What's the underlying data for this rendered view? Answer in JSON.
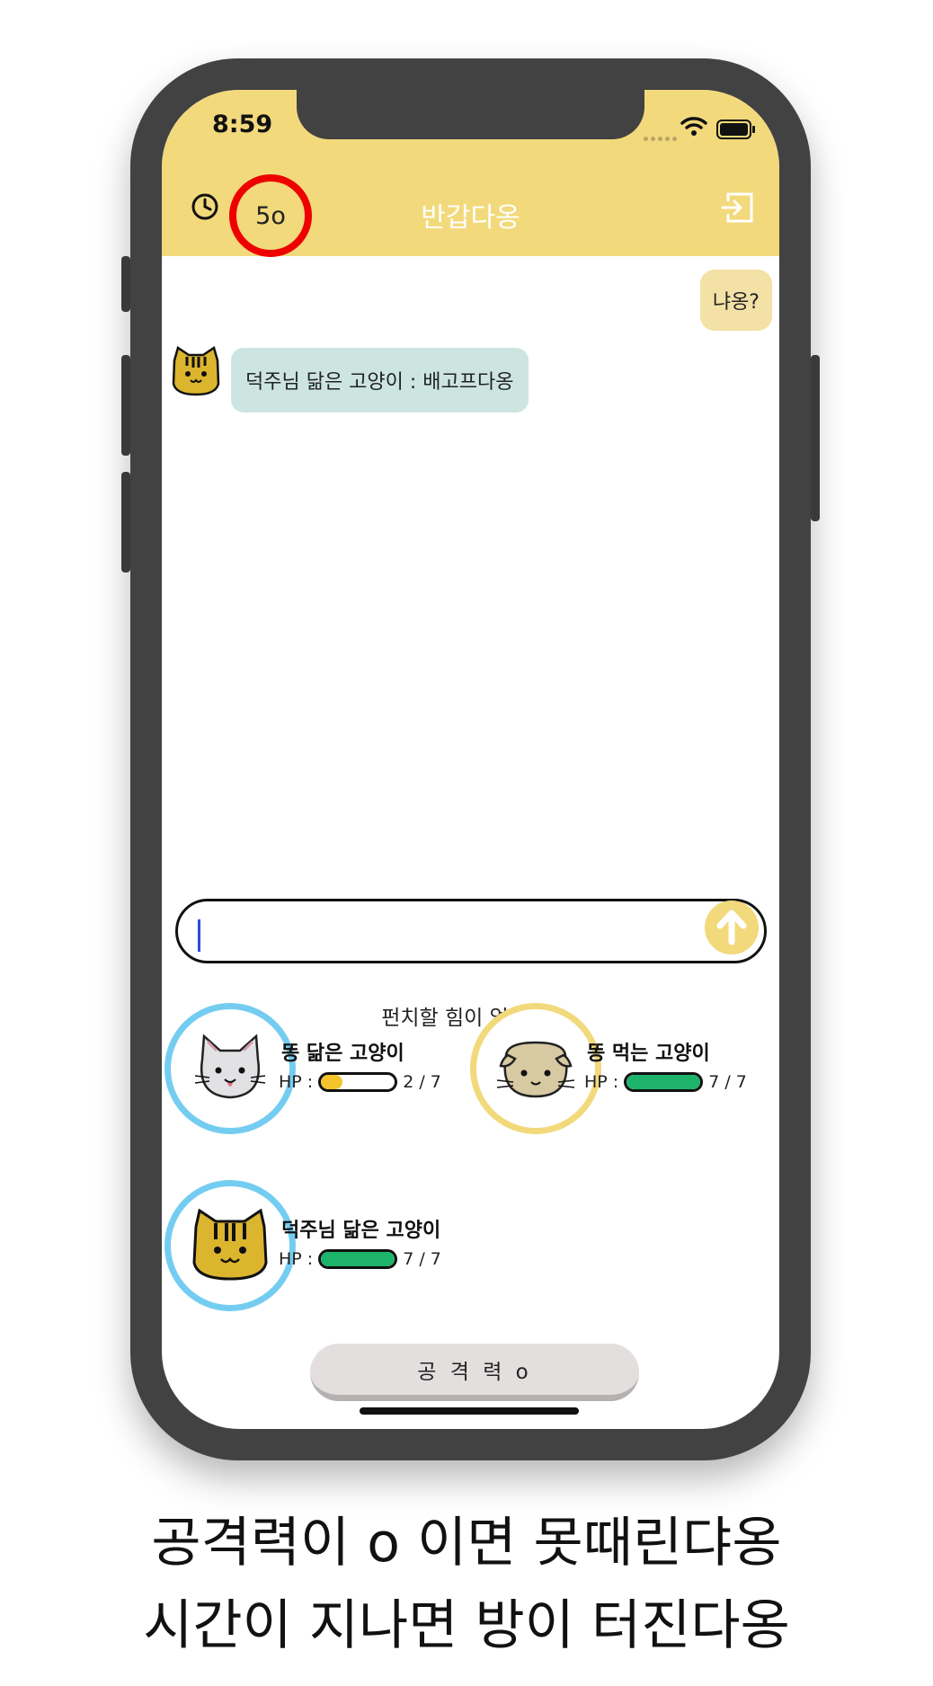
{
  "status_bar": {
    "time": "8:59"
  },
  "header": {
    "timer_value": "5o",
    "room_title": "반갑다옹"
  },
  "messages": {
    "outgoing": "냐옹?",
    "incoming": "덕주님 닮은 고양이 : 배고프다옹"
  },
  "input": {
    "value": "",
    "placeholder": ""
  },
  "status_message": "펀치할 힘이 없다옹..",
  "players": [
    {
      "name": "똥 닮은 고양이",
      "hp_label": "HP :",
      "hp_text": "2 / 7",
      "hp_fraction": 0.29,
      "hp_color": "#f5c32c",
      "ring_color": "#74cdf1"
    },
    {
      "name": "똥 먹는 고양이",
      "hp_label": "HP :",
      "hp_text": "7 / 7",
      "hp_fraction": 1.0,
      "hp_color": "#1eb36a",
      "ring_color": "#f2d97b"
    },
    {
      "name": "덕주님 닮은 고양이",
      "hp_label": "HP :",
      "hp_text": "7 / 7",
      "hp_fraction": 1.0,
      "hp_color": "#1eb36a",
      "ring_color": "#74cdf1"
    }
  ],
  "attack_button": "공 격 력 o",
  "caption": {
    "line1": "공격력이 o 이면 못때린댜옹",
    "line2": "시간이 지나면 방이 터진다옹"
  },
  "colors": {
    "header_bg": "#f2d97b",
    "timer_ring": "#ef0000",
    "outgoing_bubble": "#f3e1a5",
    "incoming_bubble": "#cce5e1",
    "phone_frame": "#424242"
  }
}
